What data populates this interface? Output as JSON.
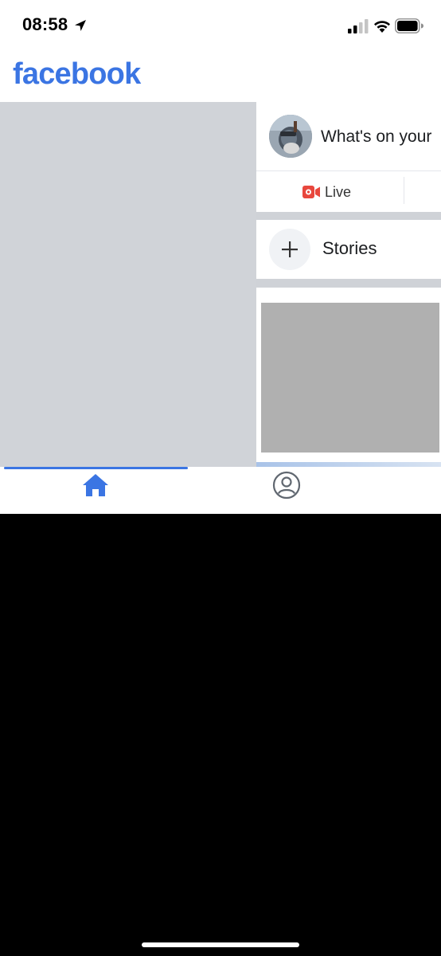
{
  "status_bar": {
    "time": "08:58",
    "icons": [
      "location-arrow-icon",
      "cellular-signal-icon",
      "wifi-icon",
      "battery-icon"
    ]
  },
  "header": {
    "logo_text": "facebook",
    "brand_color": "#3b75e3"
  },
  "composer": {
    "prompt": "What's on your",
    "live_label": "Live",
    "live_color": "#e8473d"
  },
  "stories": {
    "label": "Stories"
  },
  "tab_bar": {
    "tabs": [
      {
        "name": "home",
        "icon": "home-icon",
        "active": true
      },
      {
        "name": "profile",
        "icon": "profile-icon",
        "active": false
      }
    ]
  }
}
